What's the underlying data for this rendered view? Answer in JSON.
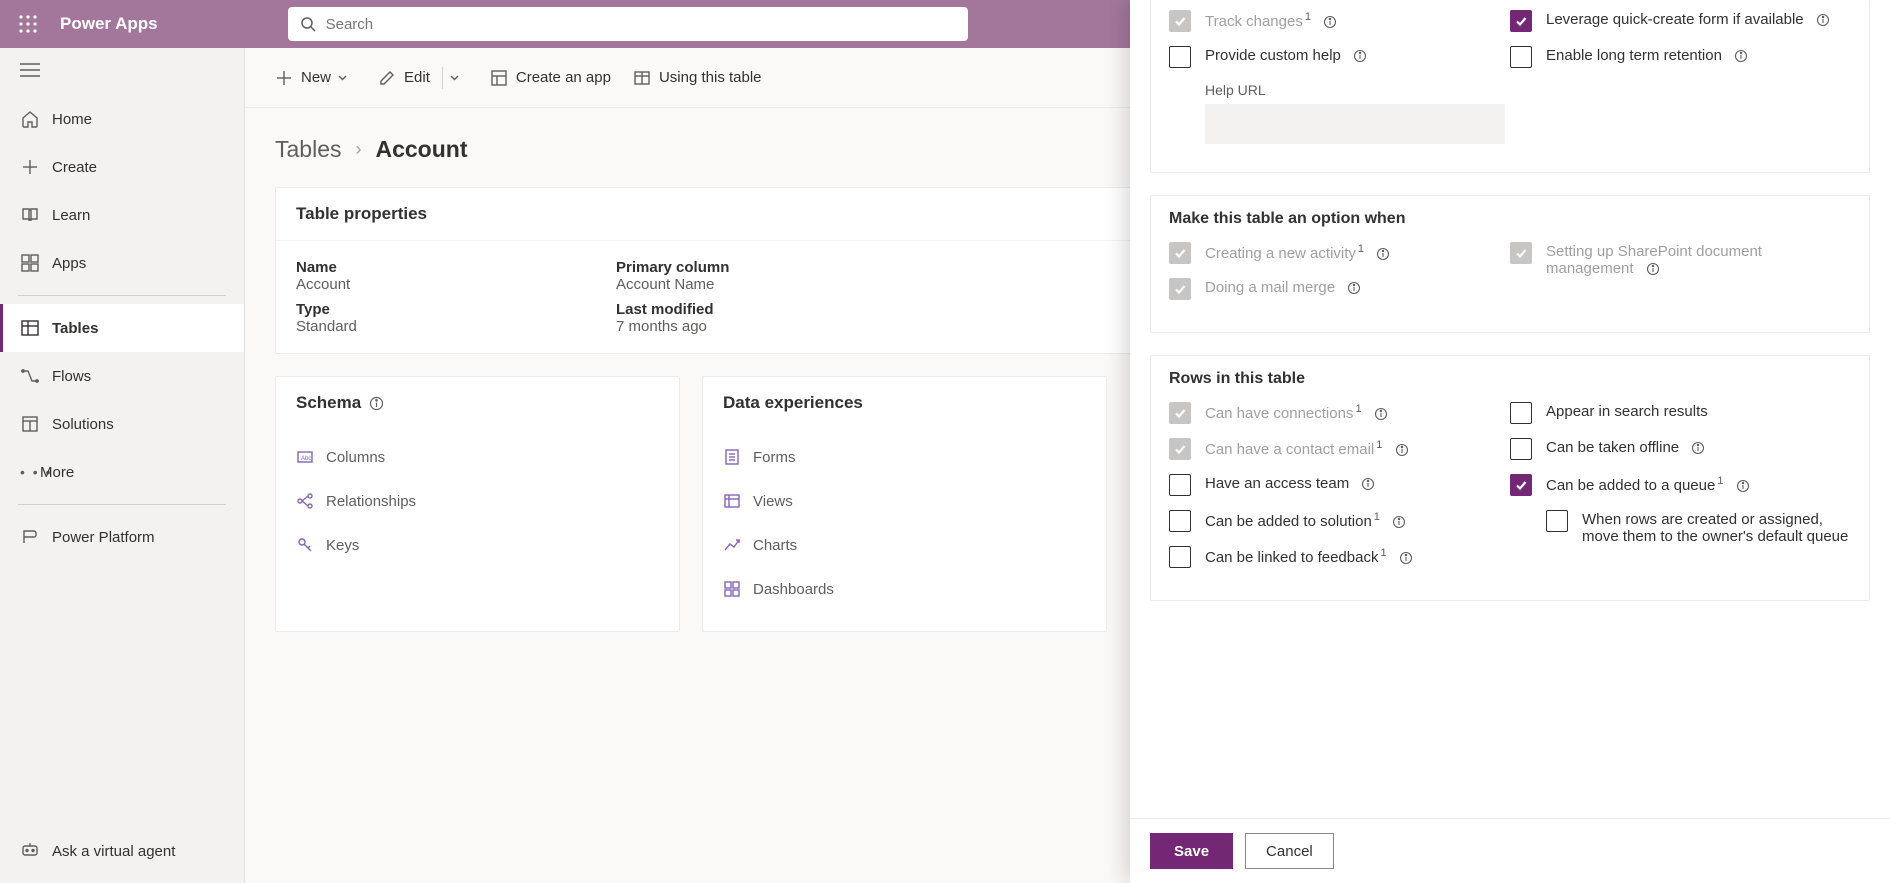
{
  "header": {
    "brand": "Power Apps",
    "search_placeholder": "Search"
  },
  "leftnav": {
    "items": [
      {
        "id": "home",
        "label": "Home"
      },
      {
        "id": "create",
        "label": "Create"
      },
      {
        "id": "learn",
        "label": "Learn"
      },
      {
        "id": "apps",
        "label": "Apps"
      },
      {
        "id": "tables",
        "label": "Tables"
      },
      {
        "id": "flows",
        "label": "Flows"
      },
      {
        "id": "solutions",
        "label": "Solutions"
      },
      {
        "id": "more",
        "label": "More"
      },
      {
        "id": "powerplatform",
        "label": "Power Platform"
      },
      {
        "id": "ask",
        "label": "Ask a virtual agent"
      }
    ]
  },
  "cmdbar": {
    "new": "New",
    "edit": "Edit",
    "create_app": "Create an app",
    "using_table": "Using this table"
  },
  "breadcrumb": {
    "root": "Tables",
    "current": "Account"
  },
  "props_card": {
    "title": "Table properties",
    "name_lbl": "Name",
    "name_val": "Account",
    "type_lbl": "Type",
    "type_val": "Standard",
    "primary_lbl": "Primary column",
    "primary_val": "Account Name",
    "modified_lbl": "Last modified",
    "modified_val": "7 months ago"
  },
  "schema_card": {
    "title": "Schema",
    "columns": "Columns",
    "relationships": "Relationships",
    "keys": "Keys"
  },
  "data_card": {
    "title": "Data experiences",
    "forms": "Forms",
    "views": "Views",
    "charts": "Charts",
    "dashboards": "Dashboards"
  },
  "panel": {
    "top_group": {
      "track_changes": "Track changes",
      "custom_help": "Provide custom help",
      "help_url_lbl": "Help URL",
      "quick_create": "Leverage quick-create form if available",
      "long_term": "Enable long term retention"
    },
    "option_group": {
      "title": "Make this table an option when",
      "new_activity": "Creating a new activity",
      "mail_merge": "Doing a mail merge",
      "sp_docmgmt": "Setting up SharePoint document management"
    },
    "rows_group": {
      "title": "Rows in this table",
      "connections": "Can have connections",
      "contact_email": "Can have a contact email",
      "access_team": "Have an access team",
      "added_solution": "Can be added to solution",
      "linked_feedback": "Can be linked to feedback",
      "appear_search": "Appear in search results",
      "taken_offline": "Can be taken offline",
      "added_queue": "Can be added to a queue",
      "default_queue": "When rows are created or assigned, move them to the owner's default queue"
    },
    "buttons": {
      "save": "Save",
      "cancel": "Cancel"
    }
  }
}
